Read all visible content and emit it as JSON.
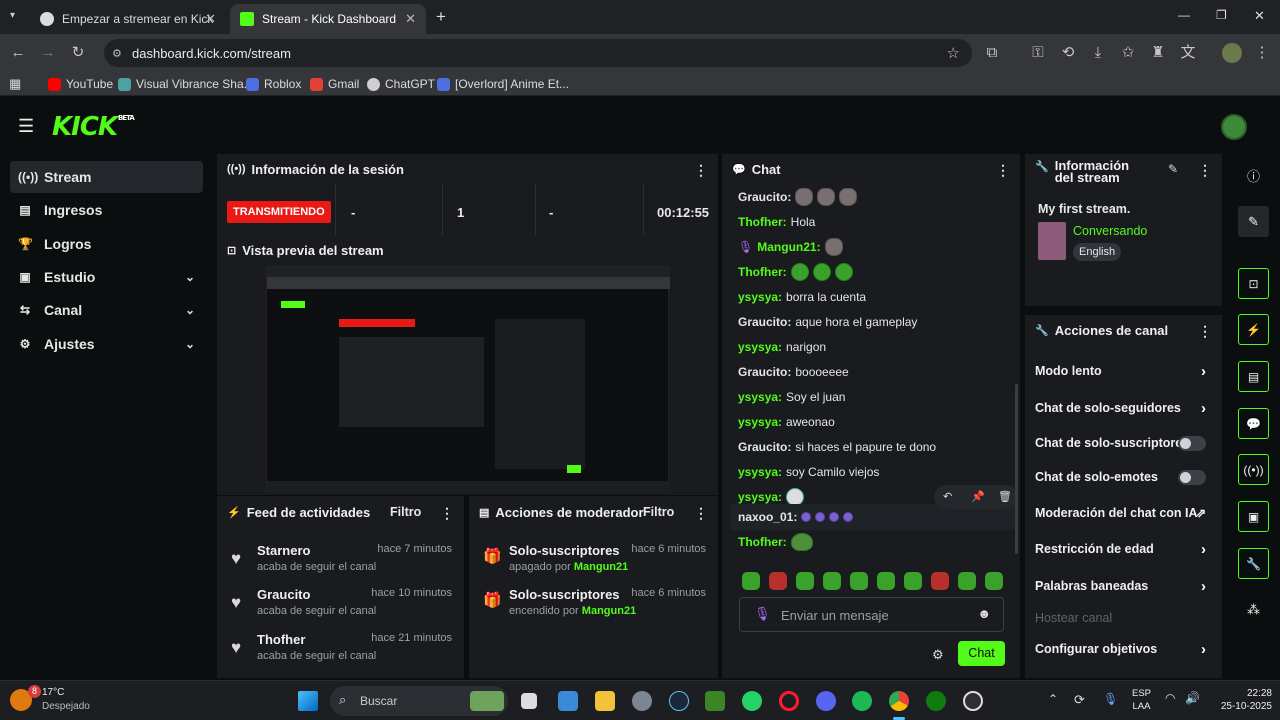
{
  "browser": {
    "tabs": [
      {
        "title": "Empezar a stremear en Kick"
      },
      {
        "title": "Stream - Kick Dashboard"
      }
    ],
    "new_tab": "+",
    "url": "dashboard.kick.com/stream",
    "bookmarks": [
      "YouTube",
      "Visual Vibrance Sha...",
      "Roblox",
      "Gmail",
      "ChatGPT",
      "[Overlord] Anime Et..."
    ]
  },
  "app": {
    "logo": "KICK",
    "logo_badge": "BETA",
    "sidebar": [
      {
        "label": "Stream",
        "icon": "broadcast-icon"
      },
      {
        "label": "Ingresos",
        "icon": "chart-icon"
      },
      {
        "label": "Logros",
        "icon": "trophy-icon"
      },
      {
        "label": "Estudio",
        "icon": "studio-icon"
      },
      {
        "label": "Canal",
        "icon": "channel-icon"
      },
      {
        "label": "Ajustes",
        "icon": "gear-icon"
      }
    ],
    "session": {
      "title": "Información de la sesión",
      "status": "TRANSMITIENDO",
      "stats": [
        "-",
        "1",
        "-",
        "00:12:55"
      ]
    },
    "preview": {
      "title": "Vista previa del stream"
    },
    "feed": {
      "title": "Feed de actividades",
      "filter": "Filtro",
      "items": [
        {
          "name": "Starnero",
          "sub": "acaba de seguir el canal",
          "time": "hace 7 minutos"
        },
        {
          "name": "Graucito",
          "sub": "acaba de seguir el canal",
          "time": "hace 10 minutos"
        },
        {
          "name": "Thofher",
          "sub": "acaba de seguir el canal",
          "time": "hace 21 minutos"
        }
      ]
    },
    "mod": {
      "title": "Acciones de moderador",
      "filter": "Filtro",
      "items": [
        {
          "name": "Solo-suscriptores",
          "state": "apagado por",
          "by": "Mangun21",
          "time": "hace 6 minutos"
        },
        {
          "name": "Solo-suscriptores",
          "state": "encendido por",
          "by": "Mangun21",
          "time": "hace 6 minutos"
        }
      ]
    },
    "chat": {
      "title": "Chat",
      "messages": [
        {
          "user": "Graucito:",
          "text": "",
          "color": "#e6e6e6"
        },
        {
          "user": "Thofher:",
          "text": "Hola",
          "color": "#53fc18"
        },
        {
          "user": "Mangun21:",
          "text": "",
          "color": "#53fc18"
        },
        {
          "user": "Thofher:",
          "text": "",
          "color": "#53fc18"
        },
        {
          "user": "ysysya:",
          "text": "borra la cuenta",
          "color": "#53fc18"
        },
        {
          "user": "Graucito:",
          "text": "aque hora el gameplay",
          "color": "#e6e6e6"
        },
        {
          "user": "ysysya:",
          "text": "narigon",
          "color": "#53fc18"
        },
        {
          "user": "Graucito:",
          "text": "boooeeee",
          "color": "#e6e6e6"
        },
        {
          "user": "ysysya:",
          "text": "Soy el juan",
          "color": "#53fc18"
        },
        {
          "user": "ysysya:",
          "text": "aweonao",
          "color": "#53fc18"
        },
        {
          "user": "Graucito:",
          "text": "si haces el papure te dono",
          "color": "#e6e6e6"
        },
        {
          "user": "ysysya:",
          "text": "soy Camilo viejos",
          "color": "#53fc18"
        },
        {
          "user": "ysysya:",
          "text": "",
          "color": "#53fc18"
        },
        {
          "user": "naxoo_01:",
          "text": "",
          "color": "#e6e6e6"
        },
        {
          "user": "Thofher:",
          "text": "",
          "color": "#53fc18"
        }
      ],
      "placeholder": "Enviar un mensaje",
      "send": "Chat"
    },
    "stream_info": {
      "title": "Información del stream",
      "stream_title": "My first stream.",
      "category": "Conversando",
      "language": "English"
    },
    "channel_actions": {
      "title": "Acciones de canal",
      "items": [
        {
          "label": "Modo lento",
          "type": "arrow"
        },
        {
          "label": "Chat de solo-seguidores",
          "type": "arrow"
        },
        {
          "label": "Chat de solo-suscriptores",
          "type": "toggle"
        },
        {
          "label": "Chat de solo-emotes",
          "type": "toggle"
        },
        {
          "label": "Moderación del chat con IA",
          "type": "external"
        },
        {
          "label": "Restricción de edad",
          "type": "arrow"
        },
        {
          "label": "Palabras baneadas",
          "type": "arrow"
        },
        {
          "label": "Hostear canal",
          "type": "disabled"
        },
        {
          "label": "Configurar objetivos",
          "type": "arrow"
        }
      ]
    }
  },
  "taskbar": {
    "weather_temp": "17°C",
    "weather_desc": "Despejado",
    "weather_badge": "8",
    "search": "Buscar",
    "lang": "ESP",
    "lang2": "LAA",
    "time": "22:28",
    "date": "25-10-2025"
  },
  "colors": {
    "accent": "#53fc18",
    "live": "#e91916"
  }
}
